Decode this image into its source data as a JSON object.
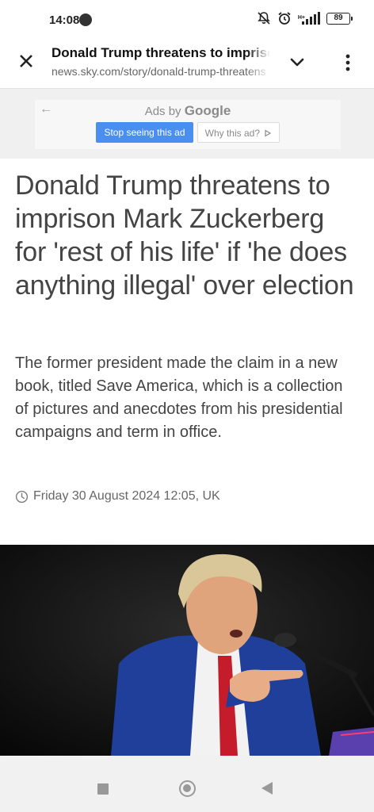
{
  "status_bar": {
    "time": "14:08",
    "network_label": "H+",
    "battery": "89",
    "icons": [
      "dnd-icon",
      "mute-icon",
      "alarm-icon",
      "signal-icon",
      "battery-icon"
    ]
  },
  "tab_header": {
    "title": "Donald Trump threatens to imprison Mark Zuckerberg",
    "url": "news.sky.com/story/donald-trump-threatens"
  },
  "ad": {
    "ads_by_prefix": "Ads by",
    "ads_by_brand": "Google",
    "stop_label": "Stop seeing this ad",
    "why_label": "Why this ad?",
    "stop_color": "#4a8ef0"
  },
  "article": {
    "headline": "Donald Trump threatens to imprison Mark Zuckerberg for 'rest of his life' if 'he does anything illegal' over election",
    "standfirst": "The former president made the claim in a new book, titled Save America, which is a collection of pictures and anecdotes from his presidential campaigns and term in office.",
    "timestamp": "Friday 30 August 2024 12:05, UK"
  },
  "nav": {
    "buttons": [
      "recents-button",
      "home-button",
      "back-button"
    ]
  }
}
